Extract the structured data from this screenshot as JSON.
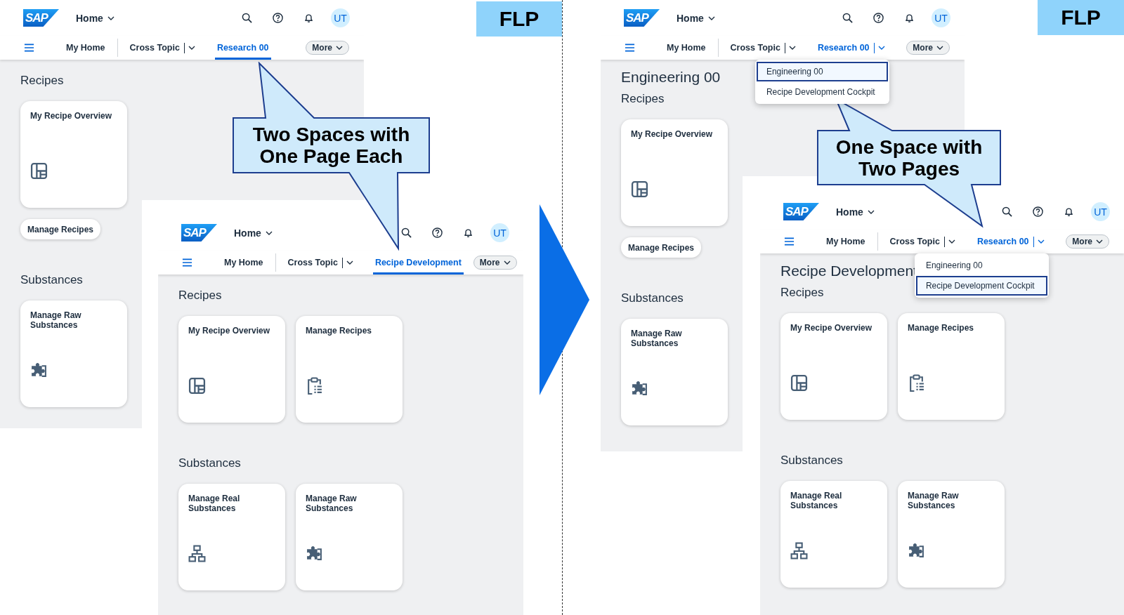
{
  "screens": [
    {
      "logo": "SAP",
      "home_menu": "Home",
      "avatar": "UT",
      "tabs": [
        {
          "label": "My Home",
          "selected": false,
          "split": false
        },
        {
          "label": "Cross Topic",
          "selected": false,
          "split": true
        },
        {
          "label": "Research 00",
          "selected": true,
          "split": false
        }
      ],
      "more": "More",
      "sections": [
        {
          "title": "Recipes",
          "tiles": [
            "My Recipe Overview"
          ],
          "links": [
            "Manage Recipes"
          ]
        },
        {
          "title": "Substances",
          "tiles": [
            "Manage Raw Substances"
          ]
        }
      ]
    },
    {
      "logo": "SAP",
      "home_menu": "Home",
      "avatar": "UT",
      "tabs": [
        {
          "label": "My Home",
          "selected": false,
          "split": false
        },
        {
          "label": "Cross Topic",
          "selected": false,
          "split": true
        },
        {
          "label": "Recipe Development",
          "selected": true,
          "split": false
        }
      ],
      "more": "More",
      "sections": [
        {
          "title": "Recipes",
          "tiles": [
            "My Recipe Overview",
            "Manage Recipes"
          ]
        },
        {
          "title": "Substances",
          "tiles": [
            "Manage Real Substances",
            "Manage Raw Substances"
          ]
        }
      ]
    },
    {
      "logo": "SAP",
      "home_menu": "Home",
      "avatar": "UT",
      "tabs": [
        {
          "label": "My Home",
          "selected": false,
          "split": false
        },
        {
          "label": "Cross Topic",
          "selected": false,
          "split": true
        },
        {
          "label": "Research 00",
          "selected": true,
          "split": true,
          "menu": [
            {
              "label": "Engineering 00",
              "selected": true
            },
            {
              "label": "Recipe Development Cockpit",
              "selected": false
            }
          ]
        }
      ],
      "more": "More",
      "page_title": "Engineering 00",
      "sections": [
        {
          "title": "Recipes",
          "tiles": [
            "My Recipe Overview"
          ],
          "links": [
            "Manage Recipes"
          ]
        },
        {
          "title": "Substances",
          "tiles": [
            "Manage Raw Substances"
          ]
        }
      ]
    },
    {
      "logo": "SAP",
      "home_menu": "Home",
      "avatar": "UT",
      "tabs": [
        {
          "label": "My Home",
          "selected": false,
          "split": false
        },
        {
          "label": "Cross Topic",
          "selected": false,
          "split": true
        },
        {
          "label": "Research 00",
          "selected": true,
          "split": true,
          "menu": [
            {
              "label": "Engineering 00",
              "selected": false
            },
            {
              "label": "Recipe Development Cockpit",
              "selected": true
            }
          ]
        }
      ],
      "more": "More",
      "page_title": "Recipe Development",
      "sections": [
        {
          "title": "Recipes",
          "tiles": [
            "My Recipe Overview",
            "Manage Recipes"
          ]
        },
        {
          "title": "Substances",
          "tiles": [
            "Manage Real Substances",
            "Manage Raw Substances"
          ]
        }
      ]
    }
  ],
  "callouts": [
    "Two Spaces with\nOne Page Each",
    "One Space with\nTwo Pages"
  ],
  "badges": [
    "FLP",
    "FLP"
  ]
}
